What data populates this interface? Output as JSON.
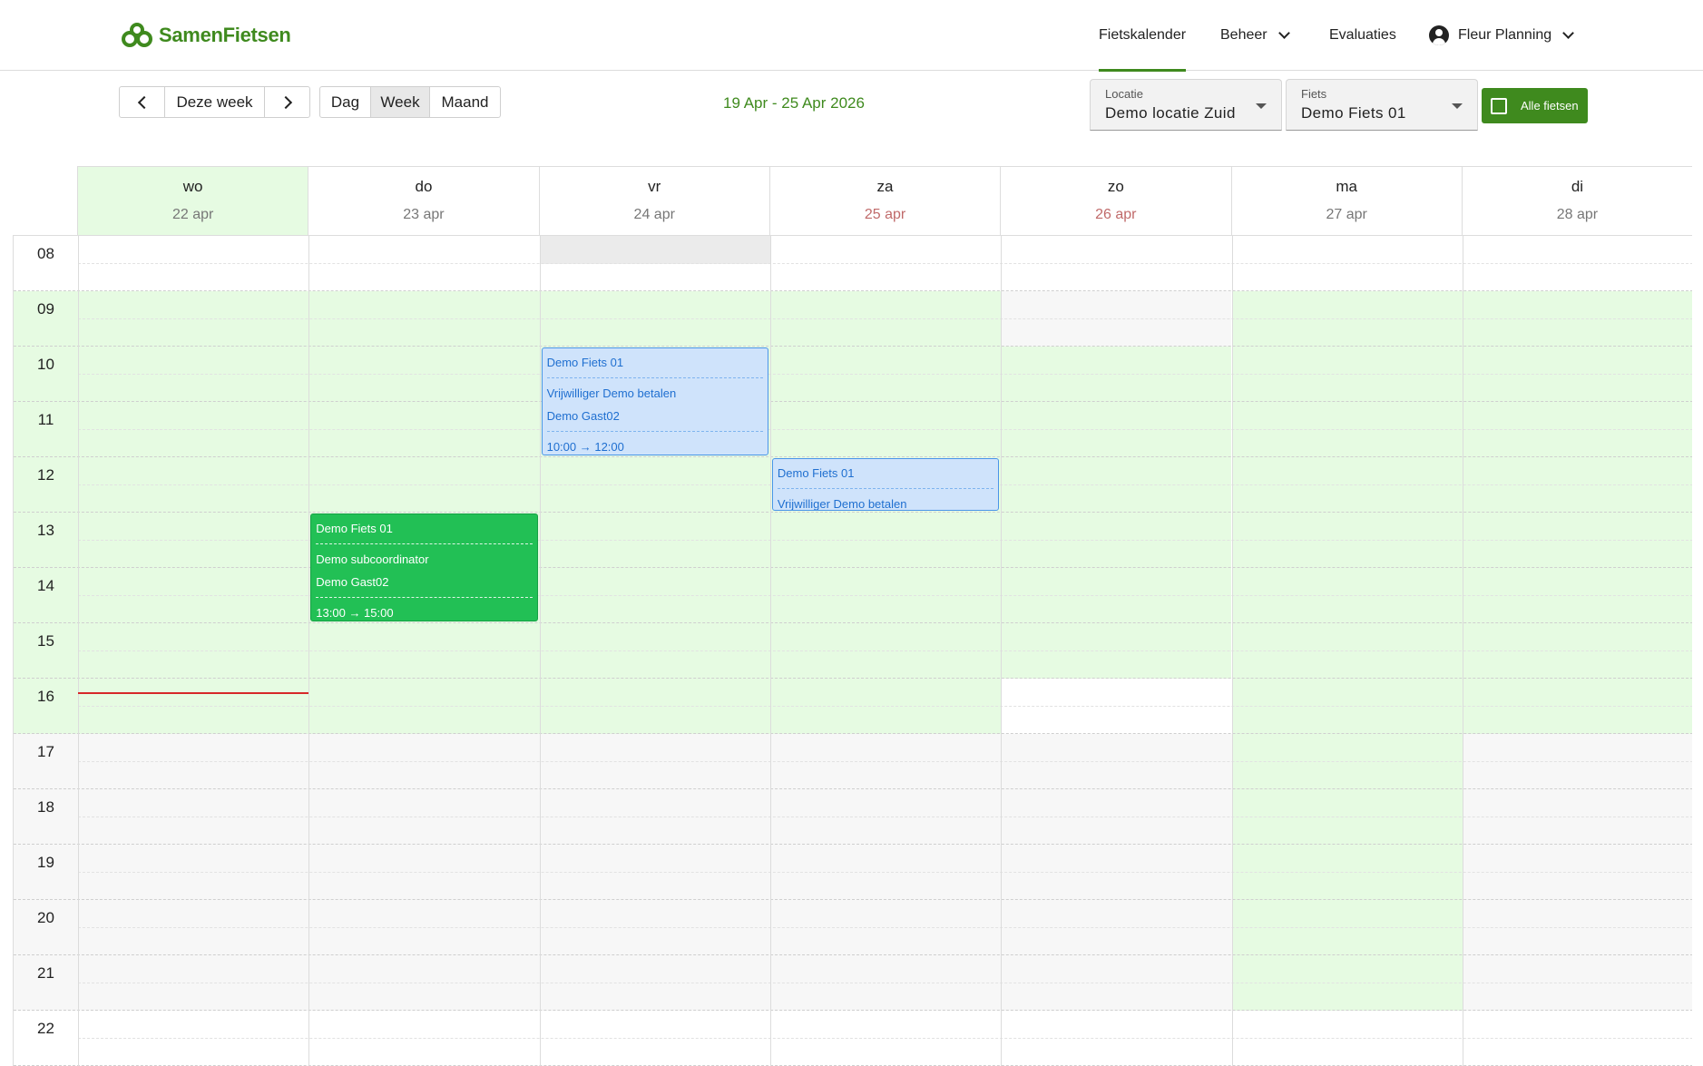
{
  "header": {
    "brand": "SamenFietsen",
    "nav": {
      "calendar": "Fietskalender",
      "admin": "Beheer",
      "evaluations": "Evaluaties",
      "user": "Fleur Planning"
    }
  },
  "toolbar": {
    "this_week": "Deze week",
    "view_day": "Dag",
    "view_week": "Week",
    "view_month": "Maand",
    "selected_view": "Week",
    "date_range": "19 Apr - 25 Apr 2026",
    "location": {
      "label": "Locatie",
      "value": "Demo locatie Zuid"
    },
    "bike": {
      "label": "Fiets",
      "value": "Demo Fiets 01"
    },
    "all_bikes": "Alle fietsen",
    "all_bikes_checked": false
  },
  "calendar": {
    "days": [
      {
        "name": "wo",
        "date": "22 apr",
        "today": true,
        "weekend": false
      },
      {
        "name": "do",
        "date": "23 apr",
        "today": false,
        "weekend": false
      },
      {
        "name": "vr",
        "date": "24 apr",
        "today": false,
        "weekend": false
      },
      {
        "name": "za",
        "date": "25 apr",
        "today": false,
        "weekend": true
      },
      {
        "name": "zo",
        "date": "26 apr",
        "today": false,
        "weekend": true
      },
      {
        "name": "ma",
        "date": "27 apr",
        "today": false,
        "weekend": false
      },
      {
        "name": "di",
        "date": "28 apr",
        "today": false,
        "weekend": false
      }
    ],
    "hours": [
      "08",
      "09",
      "10",
      "11",
      "12",
      "13",
      "14",
      "15",
      "16",
      "17",
      "18",
      "19",
      "20",
      "21",
      "22"
    ],
    "events": [
      {
        "day": 2,
        "start": 10,
        "end": 12,
        "color": "blue",
        "bike": "Demo Fiets 01",
        "volunteer": "Vrijwilliger Demo betalen",
        "guest": "Demo Gast02",
        "time": "10:00 → 12:00"
      },
      {
        "day": 3,
        "start": 12,
        "end": 13,
        "color": "blue",
        "bike": "Demo Fiets 01",
        "volunteer": "Vrijwilliger Demo betalen",
        "guest": "",
        "time": ""
      },
      {
        "day": 1,
        "start": 13,
        "end": 15,
        "color": "green",
        "bike": "Demo Fiets 01",
        "volunteer": "Demo subcoordinator",
        "guest": "Demo Gast02",
        "time": "13:00 → 15:00"
      }
    ],
    "colors": {
      "brand": "#3f8a1e",
      "available": "#e6fbe2",
      "unavailable": "#f7f7f7",
      "blocked": "#ebebeb",
      "event_blue": "#cfe3fb",
      "event_green": "#22c055",
      "now_line": "#d62828"
    }
  }
}
